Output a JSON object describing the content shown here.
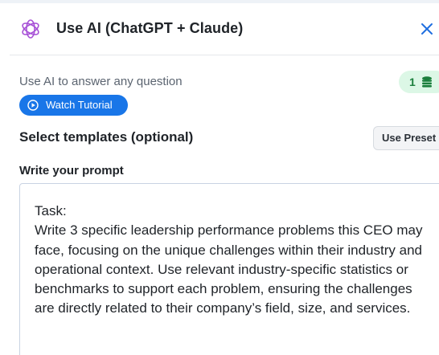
{
  "header": {
    "title": "Use AI (ChatGPT + Claude)",
    "logo_icon": "openai-logo-icon",
    "close_icon": "close-icon"
  },
  "subtitle": "Use AI to answer any question",
  "credits": {
    "count": "1",
    "icon": "coins-icon",
    "color": "#1a7f3c"
  },
  "watch_tutorial": {
    "label": "Watch Tutorial",
    "icon": "play-circle-icon",
    "color": "#1976e8"
  },
  "templates": {
    "title": "Select templates (optional)",
    "preset_label": "Use Preset"
  },
  "prompt": {
    "label": "Write your prompt",
    "text": "Task:\nWrite 3 specific leadership performance problems this CEO may face, focusing on the unique challenges within their industry and operational context. Use relevant industry-specific statistics or benchmarks to support each problem, ensuring the challenges are directly related to their company’s field, size, and services."
  }
}
